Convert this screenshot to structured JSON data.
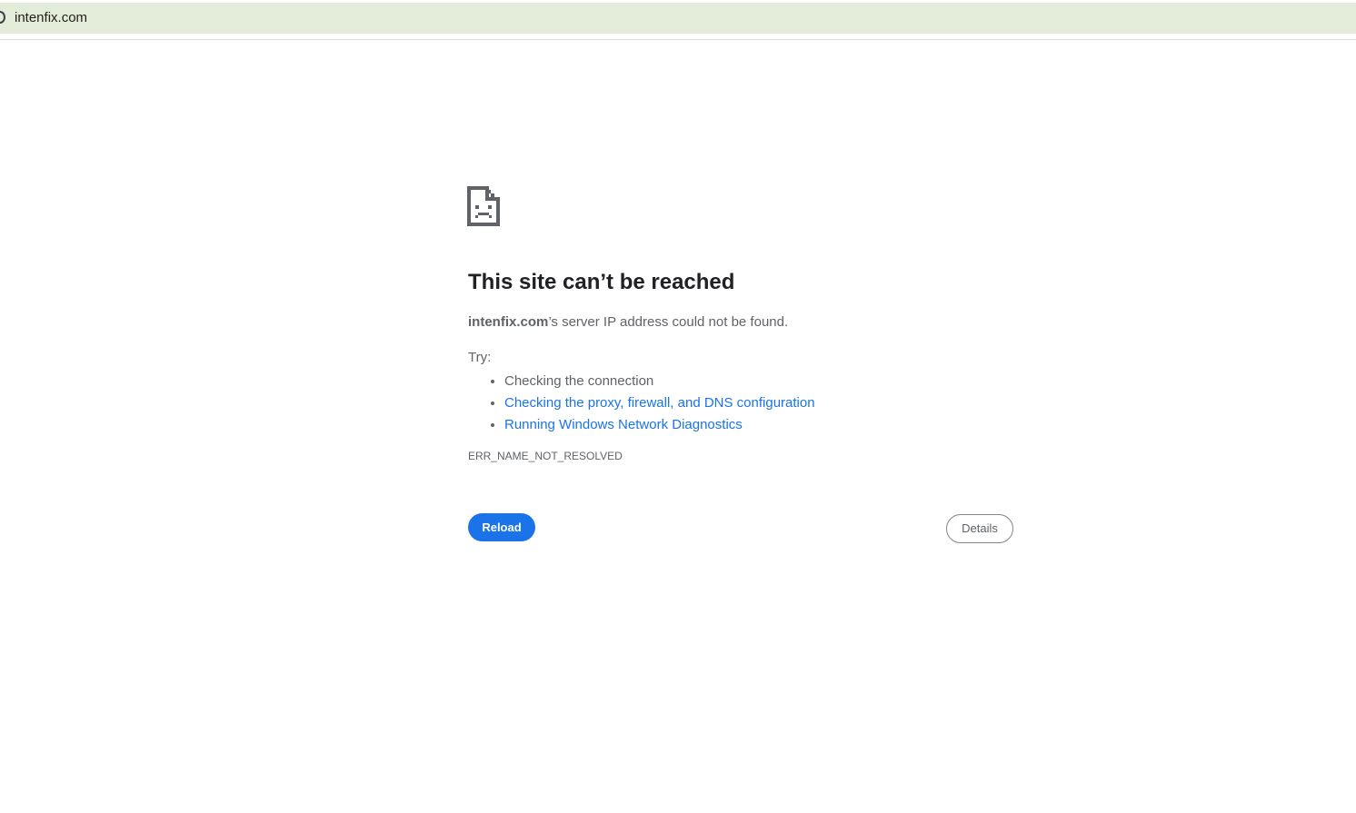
{
  "address_bar": {
    "url": "intenfix.com",
    "site_info_icon": "info-icon"
  },
  "error_page": {
    "icon": "sad-document-icon",
    "title": "This site can’t be reached",
    "summary_host": "intenfix.com",
    "summary_rest": "’s server IP address could not be found.",
    "try_label": "Try:",
    "suggestions": [
      {
        "text": "Checking the connection",
        "is_link": false
      },
      {
        "text": "Checking the proxy, firewall, and DNS configuration",
        "is_link": true
      },
      {
        "text": "Running Windows Network Diagnostics",
        "is_link": true
      }
    ],
    "error_code": "ERR_NAME_NOT_RESOLVED",
    "reload_label": "Reload",
    "details_label": "Details"
  },
  "colors": {
    "address_bar_bg": "#e3ecd9",
    "link": "#1a73e8",
    "primary_button": "#1a73e8",
    "text": "#5f6368",
    "title": "#202124"
  }
}
